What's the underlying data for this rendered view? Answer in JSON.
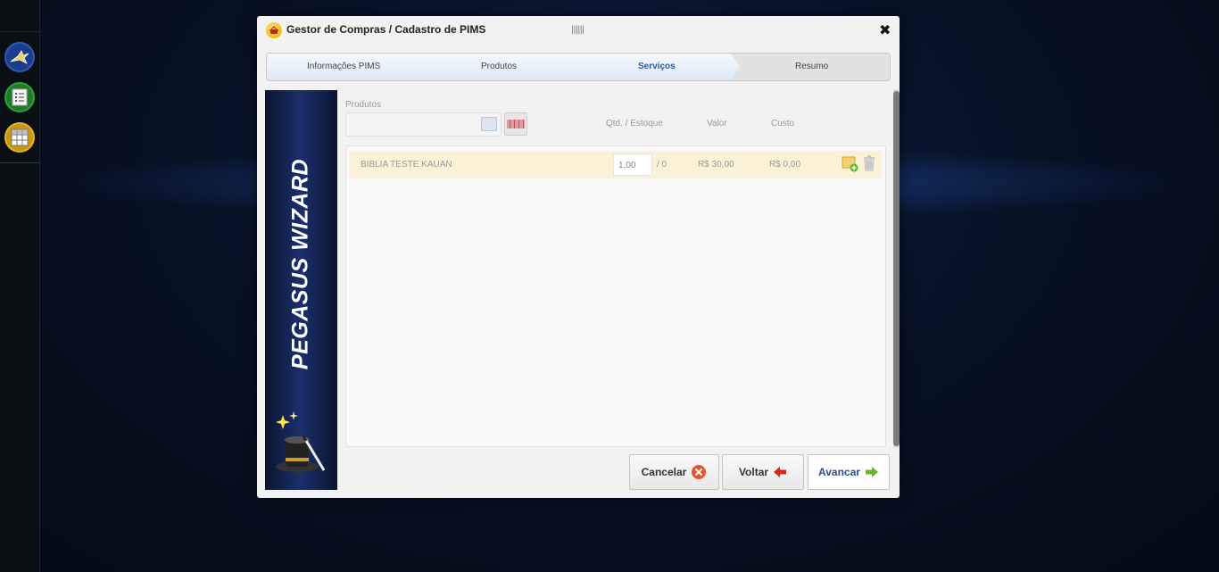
{
  "dialog": {
    "title": "Gestor de Compras / Cadastro de PIMS",
    "grip": "||||||",
    "close_label": "✖"
  },
  "steps": [
    {
      "label": "Informações PIMS",
      "state": "done"
    },
    {
      "label": "Produtos",
      "state": "done"
    },
    {
      "label": "Serviços",
      "state": "active"
    },
    {
      "label": "Resumo",
      "state": "pending"
    }
  ],
  "banner": {
    "text": "PEGASUS WIZARD"
  },
  "form": {
    "produtos_label": "Produtos",
    "produtos_value": "",
    "headers": {
      "qtd_estoque": "Qtd. / Estoque",
      "valor": "Valor",
      "custo": "Custo"
    }
  },
  "rows": [
    {
      "name": "BIBLIA TESTE KAUAN",
      "qtd": "1,00",
      "estoque": "/ 0",
      "valor": "R$ 30,00",
      "custo": "R$ 0,00"
    }
  ],
  "buttons": {
    "cancel": "Cancelar",
    "back": "Voltar",
    "next": "Avancar"
  },
  "colors": {
    "active_step": "#2b5a94",
    "row_highlight": "#fbf1d6",
    "next_text": "#2b4d8c",
    "cancel_icon": "#e8542c",
    "back_icon": "#d42a1a",
    "next_icon": "#6ab52a"
  }
}
